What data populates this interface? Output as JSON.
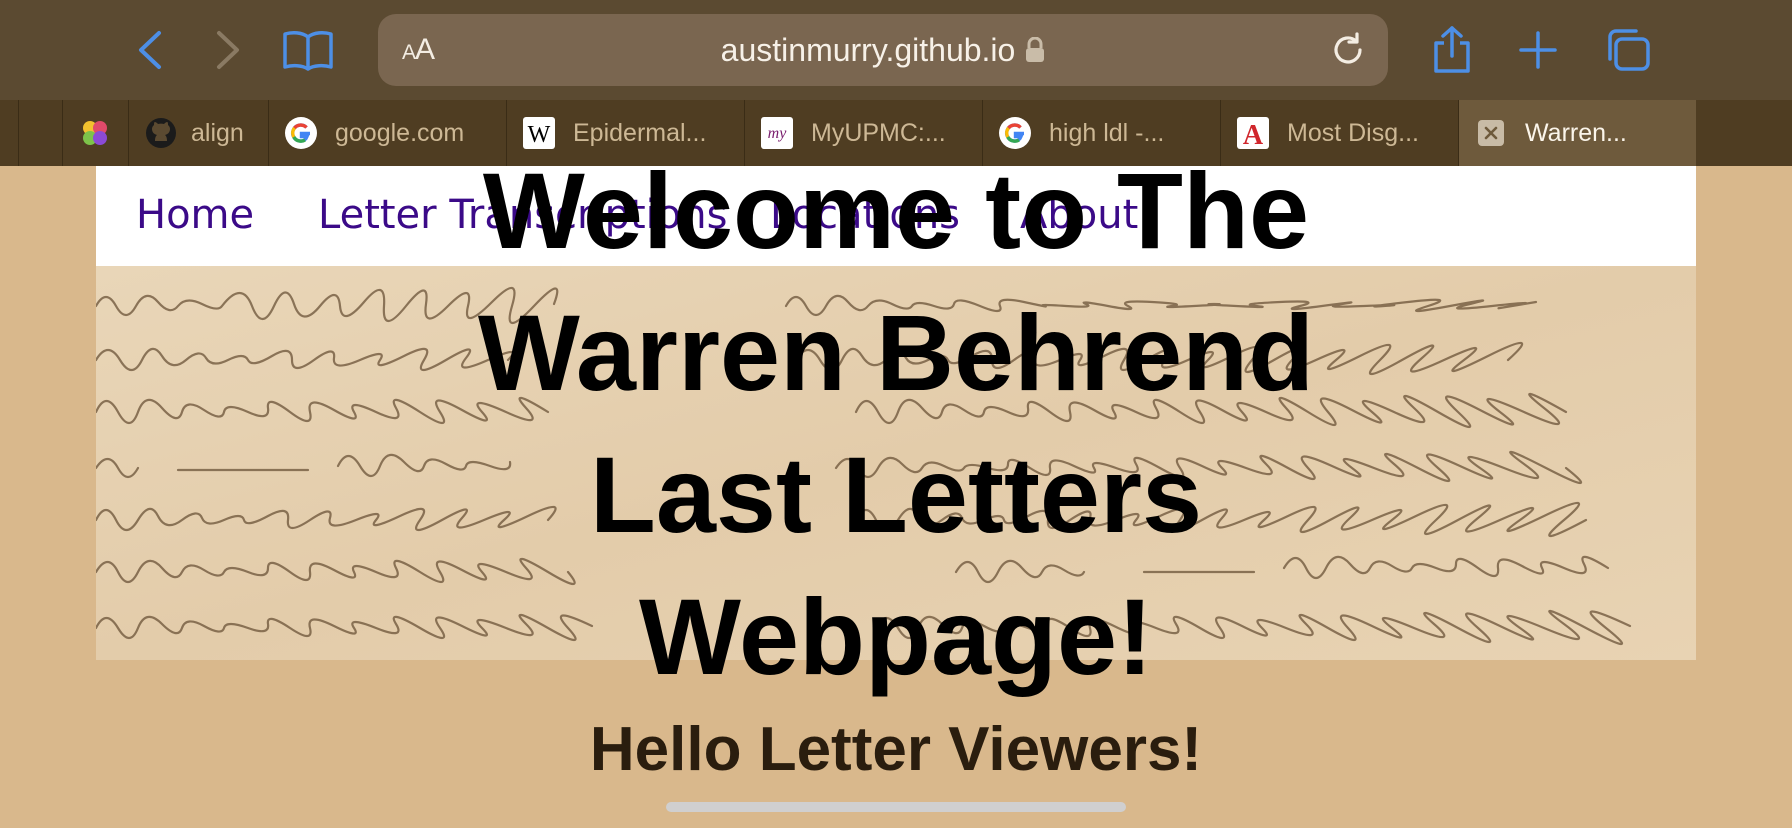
{
  "browser": {
    "aa_label_small": "A",
    "aa_label_large": "A",
    "url": "austinmurry.github.io",
    "colors": {
      "toolbar_icon": "#4d8fe6",
      "toolbar_icon_disabled": "#8a7a63"
    }
  },
  "tabs": [
    {
      "title": "",
      "icon": "multicolor-favicon"
    },
    {
      "title": "align",
      "icon": "github-icon"
    },
    {
      "title": "google.com",
      "icon": "google-icon"
    },
    {
      "title": "Epidermal...",
      "icon": "wikipedia-icon"
    },
    {
      "title": "MyUPMC:...",
      "icon": "myupmc-icon"
    },
    {
      "title": "high ldl -...",
      "icon": "google-icon"
    },
    {
      "title": "Most Disg...",
      "icon": "atlantic-icon"
    },
    {
      "title": "Warren...",
      "icon": "close-icon",
      "active": true
    }
  ],
  "nav": {
    "home": "Home",
    "letters": "Letter Transcriptions",
    "locations": "Locations",
    "about": "About"
  },
  "page": {
    "title": "Welcome to The Warren Behrend Last Letters Webpage!",
    "subtitle": "Hello Letter Viewers!"
  }
}
